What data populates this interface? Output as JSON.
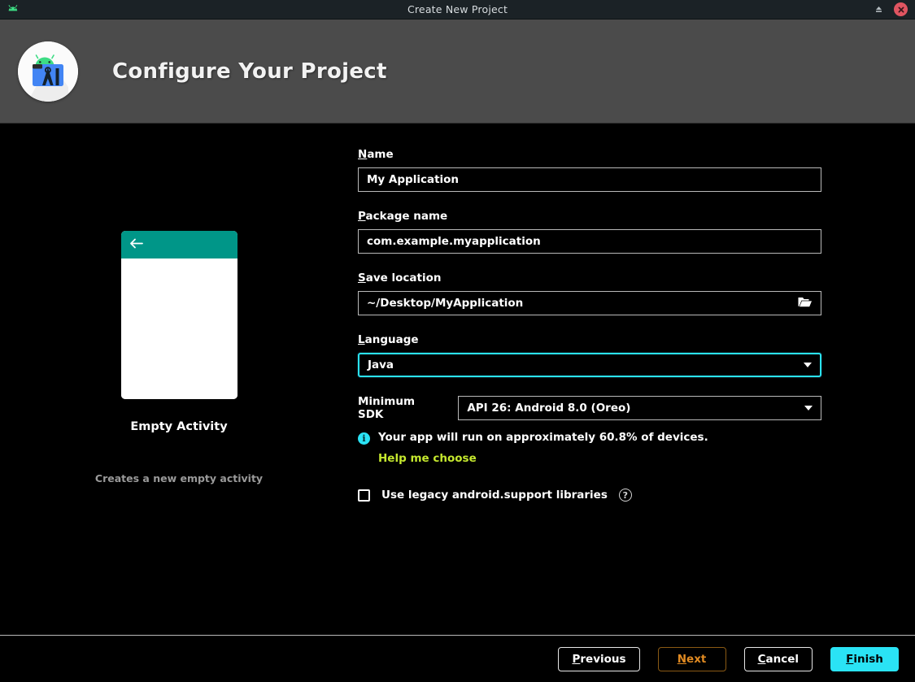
{
  "titlebar": {
    "title": "Create New Project",
    "app_icon": "android-robot-icon",
    "minimize_icon": "minimize-icon",
    "close_icon": "close-icon"
  },
  "header": {
    "title": "Configure Your Project",
    "logo_icon": "android-studio-logo-icon"
  },
  "preview": {
    "template_name": "Empty Activity",
    "description": "Creates a new empty activity",
    "back_arrow_icon": "back-arrow-icon",
    "appbar_color": "#009688"
  },
  "form": {
    "name": {
      "label": "Name",
      "mnemonic": "N",
      "label_rest": "ame",
      "value": "My Application"
    },
    "package_name": {
      "label": "Package name",
      "mnemonic": "P",
      "label_rest": "ackage name",
      "value": "com.example.myapplication"
    },
    "save_location": {
      "label": "Save location",
      "mnemonic": "S",
      "label_rest": "ave location",
      "value": "~/Desktop/MyApplication",
      "browse_icon": "folder-open-icon"
    },
    "language": {
      "label": "Language",
      "mnemonic": "L",
      "label_rest": "anguage",
      "value": "Java",
      "focused": true,
      "focus_color": "#2ae3f5",
      "caret_icon": "chevron-down-icon"
    },
    "minimum_sdk": {
      "label": "Minimum SDK",
      "value": "API 26: Android 8.0 (Oreo)",
      "caret_icon": "chevron-down-icon"
    },
    "info": {
      "icon": "info-icon",
      "text": "Your app will run on approximately 60.8% of devices.",
      "percentage": "60.8%",
      "link_text": "Help me choose",
      "link_color": "#c5e82e",
      "icon_color": "#2ae3f5"
    },
    "legacy_checkbox": {
      "label": "Use legacy android.support libraries",
      "checked": false,
      "help_icon": "question-mark-icon"
    }
  },
  "footer": {
    "buttons": [
      {
        "label": "Previous",
        "mnemonic": "P",
        "label_rest": "revious",
        "style": "outline"
      },
      {
        "label": "Next",
        "mnemonic": "N",
        "label_rest": "ext",
        "style": "next"
      },
      {
        "label": "Cancel",
        "mnemonic": "C",
        "label_rest": "ancel",
        "style": "outline"
      },
      {
        "label": "Finish",
        "mnemonic": "F",
        "label_rest": "inish",
        "style": "finish"
      }
    ]
  }
}
